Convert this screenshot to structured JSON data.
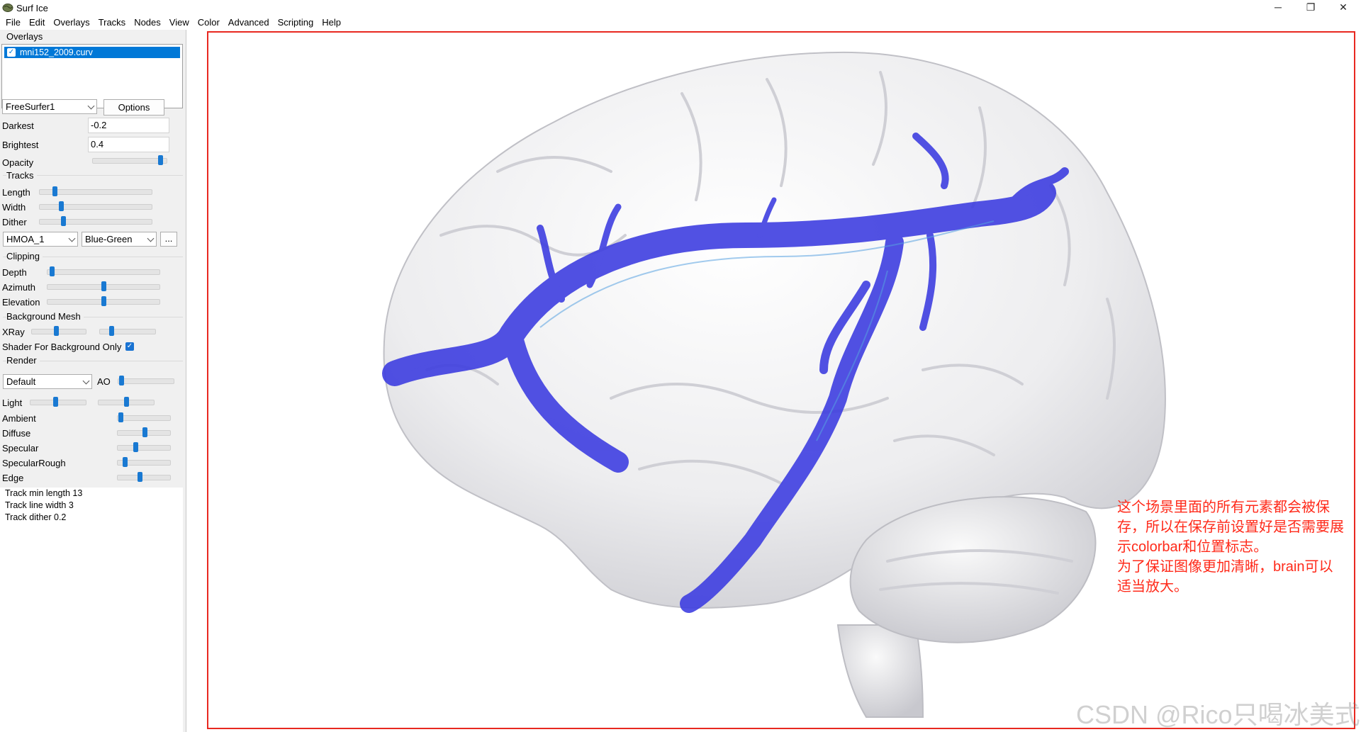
{
  "window": {
    "title": "Surf Ice",
    "minimize_glyph": "─",
    "maximize_glyph": "❐",
    "close_glyph": "✕"
  },
  "menu": [
    "File",
    "Edit",
    "Overlays",
    "Tracks",
    "Nodes",
    "View",
    "Color",
    "Advanced",
    "Scripting",
    "Help"
  ],
  "overlays": {
    "label": "Overlays",
    "items": [
      {
        "name": "mni152_2009.curv",
        "checked": true
      }
    ],
    "colormap": "FreeSurfer1",
    "options_label": "Options",
    "darkest_label": "Darkest",
    "darkest_value": "-0.2",
    "brightest_label": "Brightest",
    "brightest_value": "0.4",
    "opacity_label": "Opacity",
    "opacity_level": 0.95
  },
  "tracks": {
    "label": "Tracks",
    "length_label": "Length",
    "length_level": 0.12,
    "width_label": "Width",
    "width_level": 0.18,
    "dither_label": "Dither",
    "dither_level": 0.2,
    "atlas": "HMOA_1",
    "color_scheme": "Blue-Green",
    "more_label": "..."
  },
  "clipping": {
    "label": "Clipping",
    "depth_label": "Depth",
    "depth_level": 0.02,
    "azimuth_label": "Azimuth",
    "azimuth_level": 0.5,
    "elevation_label": "Elevation",
    "elevation_level": 0.5
  },
  "background_mesh": {
    "label": "Background Mesh",
    "xray_label": "XRay",
    "xray_level_1": 0.45,
    "xray_level_2": 0.18,
    "shader_label": "Shader For Background Only",
    "shader_checked": true
  },
  "render": {
    "label": "Render",
    "shader": "Default",
    "ao_label": "AO",
    "ao_level": 0.02,
    "light_label": "Light",
    "light_level_1": 0.45,
    "light_level_2": 0.5,
    "ambient_label": "Ambient",
    "ambient_level": 0.02,
    "diffuse_label": "Diffuse",
    "diffuse_level": 0.52,
    "specular_label": "Specular",
    "specular_level": 0.33,
    "specular_rough_label": "SpecularRough",
    "specular_rough_level": 0.1,
    "edge_label": "Edge",
    "edge_level": 0.42
  },
  "info": [
    "Track min length 13",
    "Track line width 3",
    "Track dither 0.2"
  ],
  "annotation": [
    "这个场景里面的所有元素都会被保",
    "存，所以在保存前设置好是否需要展",
    "示colorbar和位置标志。",
    "为了保证图像更加清晰，brain可以",
    "适当放大。"
  ],
  "watermark": "CSDN @Rico只喝冰美式",
  "colors": {
    "accent": "#0078d7",
    "annotation_border": "#e82820",
    "annotation_text": "#ff2a1a",
    "tract": "#3a3ae0"
  }
}
